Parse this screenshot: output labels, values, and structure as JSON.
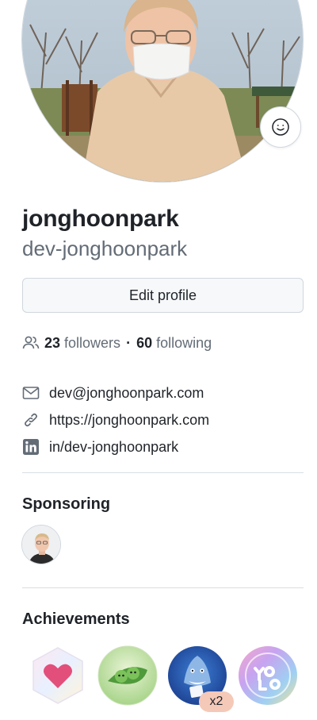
{
  "profile": {
    "name": "jonghoonpark",
    "login": "dev-jonghoonpark",
    "edit_label": "Edit profile"
  },
  "social": {
    "followers_count": "23",
    "followers_label": "followers",
    "separator": "·",
    "following_count": "60",
    "following_label": "following"
  },
  "details": {
    "email": "dev@jonghoonpark.com",
    "website": "https://jonghoonpark.com",
    "linkedin": "in/dev-jonghoonpark"
  },
  "sponsoring": {
    "title": "Sponsoring"
  },
  "achievements": {
    "title": "Achievements",
    "badges": [
      "heart-on-sleeve",
      "pair-extraordinaire",
      "pull-shark",
      "yolo"
    ],
    "pull_shark_count": "x2"
  },
  "colors": {
    "text": "#1f2328",
    "muted": "#636c76",
    "border": "#d0d7de",
    "button_bg": "#f6f8fa",
    "count_badge": "#f5c9b8"
  }
}
